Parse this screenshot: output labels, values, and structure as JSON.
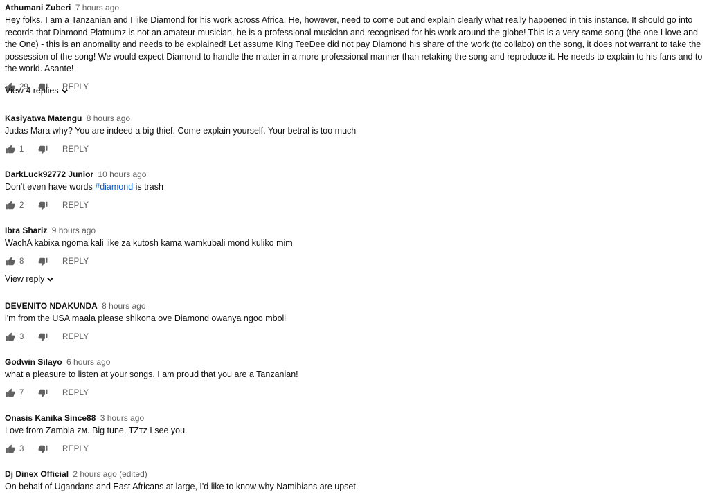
{
  "reply_label": "REPLY",
  "comments": [
    {
      "author": "Athumani Zuberi",
      "time": "7 hours ago",
      "text": "Hey folks, I am a Tanzanian and I like Diamond for his work across Africa. He, however, need to come out and explain clearly what really happened in this instance. It should go into records that Diamond Platnumz is not an amateur musician, he is a professional musician and recognised for his work around the globe! This is a very same song (the one I love and the One) - this is an anomality and needs to be explained! Let assume King TeeDee did not pay Diamond his share of the work (to collabo) on the song, it does not warrant to take the possession of the song! We would expect Diamond to handle the matter in a more professional manner than retaking the song and reproduce it.  He needs to explain to his fans and to the world. Asante!",
      "likes": "29",
      "view_replies": "View 4 replies"
    },
    {
      "author": "Kasiyatwa Matengu",
      "time": "8 hours ago",
      "text": "Judas Mara why? You are indeed a big thief. Come explain yourself. Your betral is too much",
      "likes": "1"
    },
    {
      "author": "DarkLuck92772 Junior",
      "time": "10 hours ago",
      "text_before": "Don't even have words ",
      "hashtag": "#diamond",
      "text_after": " is trash",
      "likes": "2"
    },
    {
      "author": "Ibra Shariz",
      "time": "9 hours ago",
      "text": "WachA kabixa ngoma kali like za kutosh kama wamkubali mond kuliko mim",
      "likes": "8",
      "view_replies": "View reply"
    },
    {
      "author": "DEVENITO NDAKUNDA",
      "time": "8 hours ago",
      "text": "i'm from the USA maala please shikona ove Diamond owanya ngoo mboli",
      "likes": "3"
    },
    {
      "author": "Godwin Silayo",
      "time": "6 hours ago",
      "text": "what a pleasure to listen at your songs. I am proud that you are a Tanzanian!",
      "likes": "7"
    },
    {
      "author": "Onasis Kanika Since88",
      "time": "3 hours ago",
      "text": "Love from Zambia ᴢᴍ. Big tune. TZᴛᴢ I see you.",
      "likes": "3"
    },
    {
      "author": "Dj Dinex Official",
      "time": "2 hours ago (edited)",
      "text": "On behalf of Ugandans and East Africans at large, I'd like to know why Namibians are upset."
    }
  ]
}
